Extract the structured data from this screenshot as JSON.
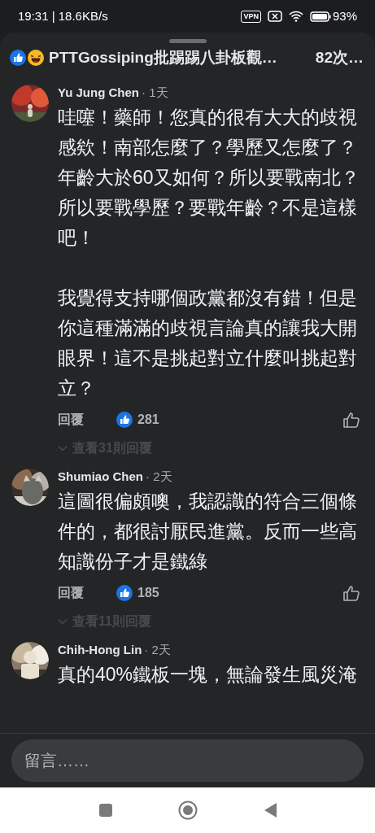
{
  "status_bar": {
    "time": "19:31 | 18.6KB/s",
    "vpn_label": "VPN",
    "battery": "93%"
  },
  "header": {
    "title": "PTTGossiping批踢踢八卦板觀…",
    "count": "82次…"
  },
  "comments": [
    {
      "author": "Yu Jung Chen",
      "time": "· 1天",
      "paragraphs": [
        "哇噻！藥師！您真的很有大大的歧視感欸！南部怎麼了？學歷又怎麼了？年齡大於60又如何？所以要戰南北？所以要戰學歷？要戰年齡？不是這樣吧！",
        "我覺得支持哪個政黨都沒有錯！但是你這種滿滿的歧視言論真的讓我大開眼界！這不是挑起對立什麼叫挑起對立？"
      ],
      "reply_label": "回覆",
      "likes": "281",
      "view_replies": "查看31則回覆"
    },
    {
      "author": "Shumiao Chen",
      "time": "· 2天",
      "paragraphs": [
        "這圖很偏頗噢，我認識的符合三個條件的，都很討厭民進黨。反而一些高知識份子才是鐵綠"
      ],
      "reply_label": "回覆",
      "likes": "185",
      "view_replies": "查看11則回覆"
    },
    {
      "author": "Chih-Hong Lin",
      "time": "· 2天",
      "paragraphs": [
        "真的40%鐵板一塊，無論發生風災淹"
      ]
    }
  ],
  "composer": {
    "placeholder": "留言……"
  }
}
